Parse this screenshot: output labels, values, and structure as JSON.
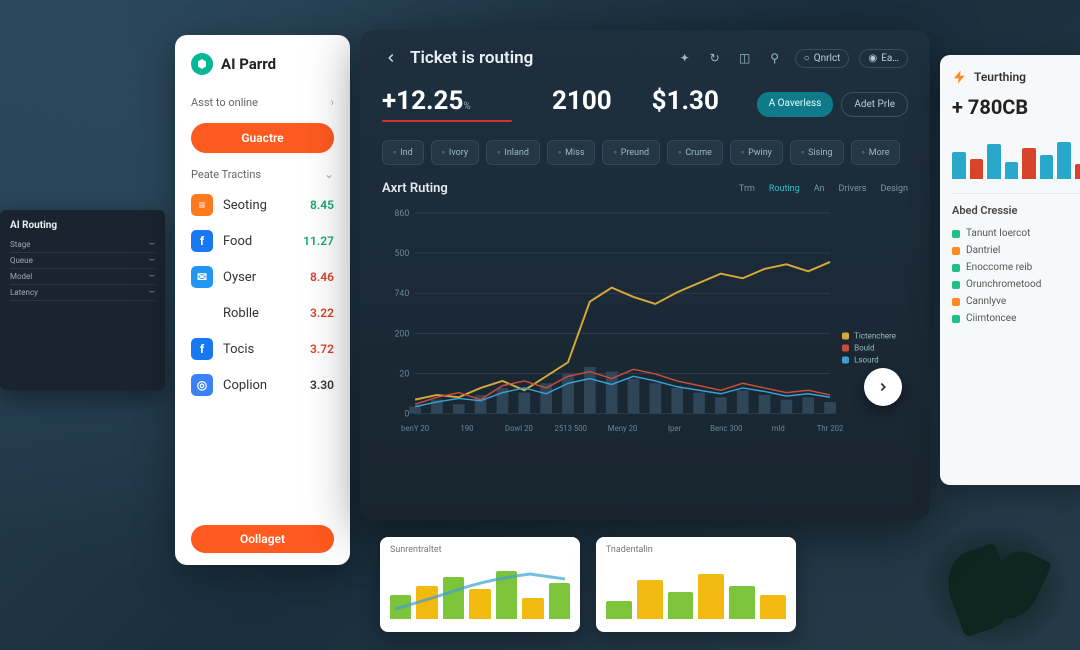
{
  "sidebar": {
    "brand": "AI Parrd",
    "sub_label": "Asst to online",
    "cta_top": "Guactre",
    "section": "Peate Tractins",
    "items": [
      {
        "icon_bg": "#ff7a1f",
        "glyph": "≡",
        "label": "Seoting",
        "value": "8.45",
        "color": "#1aa86e"
      },
      {
        "icon_bg": "#1877f2",
        "glyph": "f",
        "label": "Food",
        "value": "11.27",
        "color": "#1aa86e"
      },
      {
        "icon_bg": "#2196f3",
        "glyph": "✉",
        "label": "Oyser",
        "value": "8.46",
        "color": "#d9432a"
      },
      {
        "icon_bg": "#fff",
        "glyph": "◉",
        "label": "Roblle",
        "value": "3.22",
        "color": "#d9432a"
      },
      {
        "icon_bg": "#1877f2",
        "glyph": "f",
        "label": "Tocis",
        "value": "3.72",
        "color": "#d9432a"
      },
      {
        "icon_bg": "#3b82f6",
        "glyph": "◎",
        "label": "Coplion",
        "value": "3.30",
        "color": "#333"
      }
    ],
    "cta_bottom": "Oollaget"
  },
  "left_small": {
    "title": "AI Routing",
    "rows": [
      {
        "k": "Stage",
        "v": "—"
      },
      {
        "k": "Queue",
        "v": "—"
      },
      {
        "k": "Model",
        "v": "—"
      },
      {
        "k": "Latency",
        "v": "—"
      }
    ]
  },
  "main": {
    "title": "Ticket is routing",
    "toolbar_label": "Qnrlct",
    "stats": [
      {
        "value": "+12.25",
        "suffix": "%"
      },
      {
        "value": "2100",
        "suffix": ""
      },
      {
        "value": "$1.30",
        "suffix": ""
      }
    ],
    "actions": {
      "primary": "A Oaverless",
      "outline": "Adet Prle"
    },
    "filters": [
      "Ind",
      "Ivory",
      "Inland",
      "Miss",
      "Preund",
      "Crume",
      "Pwiny",
      "Sising",
      "More"
    ],
    "chart_title": "Axrt Ruting",
    "chart_tabs": [
      "Trm",
      "Routing",
      "An",
      "Drivers",
      "Design"
    ],
    "chart_active_tab": 1,
    "legend": [
      {
        "label": "Tictenchere",
        "color": "#d4a83a"
      },
      {
        "label": "Bould",
        "color": "#c94d3a"
      },
      {
        "label": "Lsourd",
        "color": "#3aa0d4"
      }
    ],
    "x_labels": [
      "benY 20",
      "190",
      "Dowl 20",
      "2513 500",
      "Meny 20",
      "Iper",
      "Benc 300",
      "mld",
      "Thr 202"
    ],
    "y_labels": [
      "860",
      "500",
      "740",
      "200",
      "20",
      "0"
    ]
  },
  "chart_data": {
    "type": "line",
    "title": "Axrt Ruting",
    "xlabel": "",
    "ylabel": "",
    "ylim": [
      0,
      860
    ],
    "x": [
      0,
      1,
      2,
      3,
      4,
      5,
      6,
      7,
      8,
      9,
      10,
      11,
      12,
      13,
      14,
      15,
      16,
      17,
      18,
      19
    ],
    "series": [
      {
        "name": "Tictenchere",
        "color": "#d4a83a",
        "values": [
          60,
          80,
          70,
          110,
          140,
          100,
          160,
          220,
          480,
          540,
          500,
          470,
          520,
          560,
          600,
          580,
          620,
          640,
          610,
          650
        ]
      },
      {
        "name": "Bould",
        "color": "#c94d3a",
        "values": [
          40,
          70,
          90,
          60,
          120,
          140,
          110,
          160,
          180,
          150,
          190,
          170,
          140,
          120,
          100,
          130,
          110,
          90,
          100,
          80
        ]
      },
      {
        "name": "Lsourd",
        "color": "#3aa0d4",
        "values": [
          30,
          50,
          65,
          55,
          90,
          110,
          85,
          130,
          150,
          125,
          160,
          140,
          115,
          100,
          85,
          110,
          95,
          75,
          85,
          70
        ]
      }
    ],
    "bars": [
      30,
      60,
      40,
      80,
      110,
      90,
      130,
      170,
      200,
      180,
      150,
      130,
      110,
      90,
      70,
      100,
      80,
      60,
      70,
      50
    ]
  },
  "right": {
    "title": "Teurthing",
    "stat": "+ 780CB",
    "bars": [
      {
        "h": 55,
        "c": "#2aa8c9"
      },
      {
        "h": 40,
        "c": "#d9432a"
      },
      {
        "h": 70,
        "c": "#2aa8c9"
      },
      {
        "h": 35,
        "c": "#2aa8c9"
      },
      {
        "h": 62,
        "c": "#d9432a"
      },
      {
        "h": 48,
        "c": "#2aa8c9"
      },
      {
        "h": 75,
        "c": "#2aa8c9"
      },
      {
        "h": 30,
        "c": "#d9432a"
      }
    ],
    "section": "Abed Cressie",
    "items": [
      {
        "c": "#1fbf88",
        "t": "Tanunt Ioercot"
      },
      {
        "c": "#ff8a1f",
        "t": "Dantriel"
      },
      {
        "c": "#1fbf88",
        "t": "Enoccome reib"
      },
      {
        "c": "#1fbf88",
        "t": "Orunchrometood"
      },
      {
        "c": "#ff8a1f",
        "t": "Cannlyve"
      },
      {
        "c": "#1fbf88",
        "t": "Ciimtoncee"
      }
    ]
  },
  "bottom": {
    "card1": {
      "title": "Sunrentraltet",
      "bars": [
        {
          "h": 40,
          "c": "#7cc43a"
        },
        {
          "h": 55,
          "c": "#f2b90f"
        },
        {
          "h": 70,
          "c": "#7cc43a"
        },
        {
          "h": 50,
          "c": "#f2b90f"
        },
        {
          "h": 80,
          "c": "#7cc43a"
        },
        {
          "h": 35,
          "c": "#f2b90f"
        },
        {
          "h": 60,
          "c": "#7cc43a"
        }
      ]
    },
    "card2": {
      "title": "Tnadentalin",
      "bars": [
        {
          "h": 30,
          "c": "#7cc43a"
        },
        {
          "h": 65,
          "c": "#f2b90f"
        },
        {
          "h": 45,
          "c": "#7cc43a"
        },
        {
          "h": 75,
          "c": "#f2b90f"
        },
        {
          "h": 55,
          "c": "#7cc43a"
        },
        {
          "h": 40,
          "c": "#f2b90f"
        }
      ]
    }
  }
}
